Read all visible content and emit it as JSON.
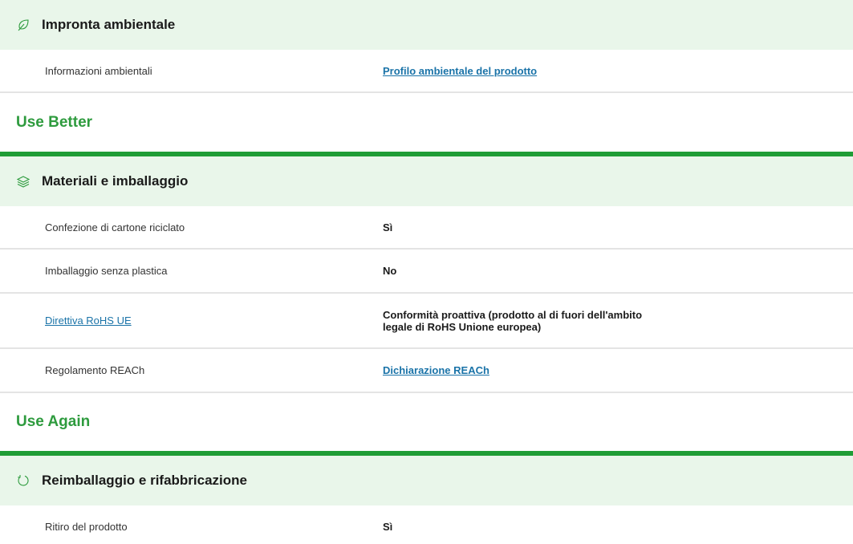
{
  "sections": [
    {
      "header": "Impronta ambientale",
      "icon": "leaf-icon",
      "rows": [
        {
          "label": "Informazioni ambientali",
          "value": "Profilo ambientale del prodotto",
          "value_is_link": true
        }
      ]
    },
    {
      "section_title": "Use Better",
      "header": "Materiali e imballaggio",
      "icon": "layers-icon",
      "rows": [
        {
          "label": "Confezione di cartone riciclato",
          "value": "Sì"
        },
        {
          "label": "Imballaggio senza plastica",
          "value": "No"
        },
        {
          "label": "Direttiva RoHS UE",
          "label_is_link": true,
          "value_line1": "Conformità proattiva (prodotto al di fuori dell'ambito",
          "value_line2": "legale di RoHS Unione europea)"
        },
        {
          "label": "Regolamento REACh",
          "value": "Dichiarazione REACh",
          "value_is_link": true
        }
      ]
    },
    {
      "section_title": "Use Again",
      "header": "Reimballaggio e rifabbricazione",
      "icon": "refresh-icon",
      "rows": [
        {
          "label": "Ritiro del prodotto",
          "value": "Sì"
        }
      ]
    }
  ],
  "colors": {
    "header_bg": "#e9f6ea",
    "section_title": "#2e9b3e",
    "divider_bar": "#1f9d36",
    "link": "#1a73a8"
  }
}
